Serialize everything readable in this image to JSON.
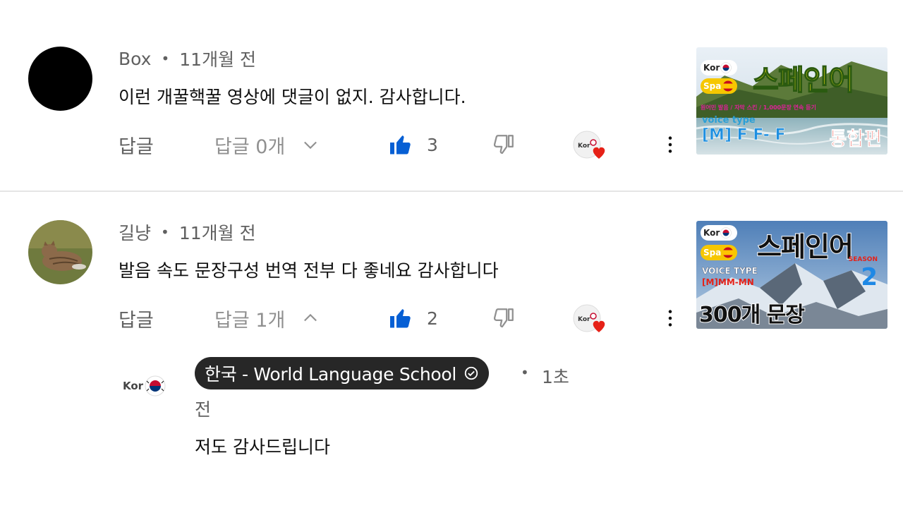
{
  "comments": [
    {
      "author": "Box",
      "time": "11개월 전",
      "text": "이런 개꿀핵꿀 영상에 댓글이 없지. 감사합니다.",
      "reply_label": "답글",
      "replies_label": "답글 0개",
      "likes": "3",
      "thumbnail": {
        "logo_top": "Kor",
        "logo_bottom": "Spa",
        "title": "스페인어",
        "subtitle": "원어민 발음 / 자막 스킨 / 1,000문장 연속 듣기",
        "voice_label": "voice type",
        "voice_value": "[M] F F- F",
        "badge": "통합편"
      }
    },
    {
      "author": "길냥",
      "time": "11개월 전",
      "text": "발음 속도 문장구성 번역 전부 다 좋네요 감사합니다",
      "reply_label": "답글",
      "replies_label": "답글 1개",
      "likes": "2",
      "thumbnail": {
        "logo_top": "Kor",
        "logo_bottom": "Spa",
        "title": "스페인어",
        "season": "SEASON",
        "season_num": "2",
        "voice_label": "VOICE TYPE",
        "voice_value": "[M]MM-MN",
        "badge": "300개 문장"
      }
    }
  ],
  "reply": {
    "author": "한국 - World Language School",
    "time": "1초 전",
    "text": "저도 감사드립니다",
    "avatar_text": "Kor"
  },
  "colors": {
    "like_blue": "#065fd4",
    "heart_red": "#e62117",
    "meta_gray": "#606060",
    "chip_bg": "#272727"
  },
  "icons": [
    "thumbs-up-icon",
    "thumbs-down-icon",
    "chevron-down-icon",
    "chevron-up-icon",
    "more-vert-icon",
    "creator-heart-icon",
    "verified-icon",
    "korea-flag-icon"
  ]
}
